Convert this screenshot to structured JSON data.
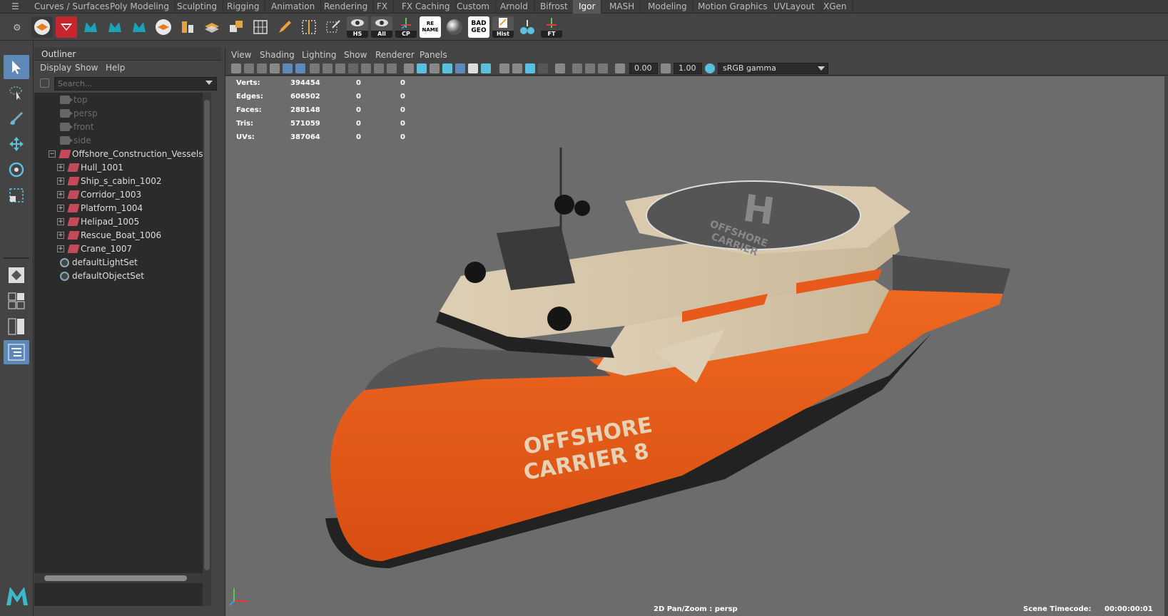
{
  "shelf_tabs": [
    "Curves / Surfaces",
    "Poly Modeling",
    "Sculpting",
    "Rigging",
    "Animation",
    "Rendering",
    "FX",
    "FX Caching",
    "Custom",
    "Arnold",
    "Bifrost",
    "Igor",
    "MASH",
    "Modeling",
    "Motion Graphics",
    "UVLayout",
    "XGen"
  ],
  "active_shelf_tab": "Igor",
  "shelf_captions": {
    "hs": "HS",
    "all": "All",
    "cp": "CP",
    "rename": "RE NAME",
    "badgeo": "BAD GEO",
    "hist": "Hist",
    "ft": "FT"
  },
  "outliner": {
    "title": "Outliner",
    "menu": [
      "Display",
      "Show",
      "Help"
    ],
    "search_placeholder": "Search...",
    "cameras": [
      "top",
      "persp",
      "front",
      "side"
    ],
    "root": "Offshore_Construction_Vessels_OCV",
    "children": [
      "Hull_1001",
      "Ship_s_cabin_1002",
      "Corridor_1003",
      "Platform_1004",
      "Helipad_1005",
      "Rescue_Boat_1006",
      "Crane_1007"
    ],
    "sets": [
      "defaultLightSet",
      "defaultObjectSet"
    ]
  },
  "viewport": {
    "menu": [
      "View",
      "Shading",
      "Lighting",
      "Show",
      "Renderer",
      "Panels"
    ],
    "exposure": "0.00",
    "gamma": "1.00",
    "color_space": "sRGB gamma",
    "hud": [
      {
        "label": "Verts:",
        "value": "394454",
        "a": "0",
        "b": "0"
      },
      {
        "label": "Edges:",
        "value": "606502",
        "a": "0",
        "b": "0"
      },
      {
        "label": "Faces:",
        "value": "288148",
        "a": "0",
        "b": "0"
      },
      {
        "label": "Tris:",
        "value": "571059",
        "a": "0",
        "b": "0"
      },
      {
        "label": "UVs:",
        "value": "387064",
        "a": "0",
        "b": "0"
      }
    ],
    "camera_label": "2D Pan/Zoom : persp",
    "timecode_label": "Scene Timecode:",
    "timecode_value": "00:00:00:01"
  },
  "ship": {
    "hull_text_line1": "OFFSHORE",
    "hull_text_line2": "CARRIER 8",
    "helipad_line1": "OFFSHORE",
    "helipad_line2": "CARRIER",
    "helipad_letter": "H"
  },
  "colors": {
    "hull_orange": "#e85a1c",
    "hull_dark": "#222222",
    "superstructure": "#d9c9ad",
    "viewport_bg": "#6c6c6c",
    "selection_blue": "#5d88b8"
  }
}
